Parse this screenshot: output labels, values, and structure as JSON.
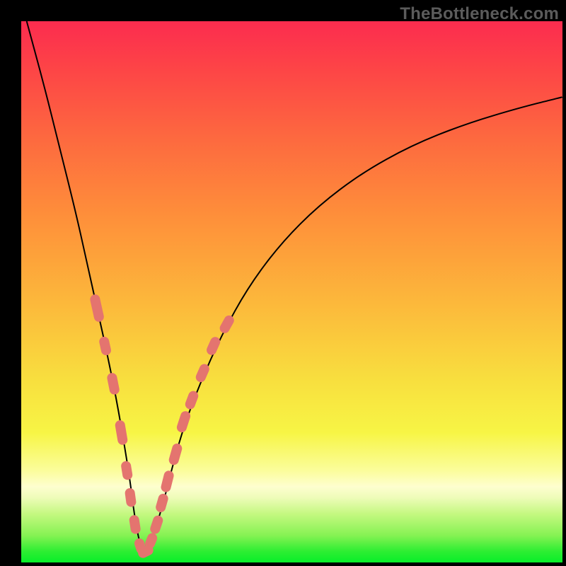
{
  "watermark": "TheBottleneck.com",
  "colors": {
    "background": "#000000",
    "marker": "#e4746f",
    "curve": "#000000"
  },
  "chart_data": {
    "type": "line",
    "title": "",
    "xlabel": "",
    "ylabel": "",
    "xlim": [
      0,
      100
    ],
    "ylim": [
      0,
      100
    ],
    "grid": false,
    "legend": false,
    "axes_visible": false,
    "description": "V-shaped bottleneck curve. Y value represents mismatch/bottleneck percentage (high = red region near top, low = green region near bottom). Minimum around x≈22.",
    "series": [
      {
        "name": "bottleneck-curve",
        "x": [
          1,
          4,
          7,
          10,
          12,
          14,
          16,
          18,
          20,
          21,
          22,
          23,
          24,
          26,
          28,
          30,
          33,
          37,
          42,
          48,
          55,
          63,
          72,
          82,
          92,
          100
        ],
        "values": [
          100,
          89,
          77,
          65,
          56,
          47,
          38,
          28,
          16,
          8,
          3,
          2,
          4,
          10,
          18,
          25,
          33,
          42,
          51,
          59,
          66,
          72,
          77,
          81,
          84,
          86
        ]
      }
    ],
    "markers": {
      "name": "highlighted-points",
      "description": "Salmon pill-shaped markers clustered near curve minimum and lower slopes.",
      "points": [
        {
          "x": 14.0,
          "y": 47,
          "len": 6
        },
        {
          "x": 15.5,
          "y": 40,
          "len": 3
        },
        {
          "x": 17.0,
          "y": 33,
          "len": 4
        },
        {
          "x": 18.5,
          "y": 24,
          "len": 5
        },
        {
          "x": 19.5,
          "y": 17,
          "len": 3
        },
        {
          "x": 20.2,
          "y": 12,
          "len": 3
        },
        {
          "x": 21.0,
          "y": 7,
          "len": 3
        },
        {
          "x": 22.0,
          "y": 3,
          "len": 2
        },
        {
          "x": 23.0,
          "y": 2,
          "len": 2
        },
        {
          "x": 24.0,
          "y": 4,
          "len": 2
        },
        {
          "x": 25.0,
          "y": 7,
          "len": 3
        },
        {
          "x": 26.0,
          "y": 11,
          "len": 3
        },
        {
          "x": 27.0,
          "y": 15,
          "len": 4
        },
        {
          "x": 28.5,
          "y": 20,
          "len": 4
        },
        {
          "x": 30.0,
          "y": 26,
          "len": 4
        },
        {
          "x": 31.5,
          "y": 30,
          "len": 3
        },
        {
          "x": 33.5,
          "y": 35,
          "len": 3
        },
        {
          "x": 35.5,
          "y": 40,
          "len": 3
        },
        {
          "x": 38.0,
          "y": 44,
          "len": 3
        }
      ]
    }
  }
}
